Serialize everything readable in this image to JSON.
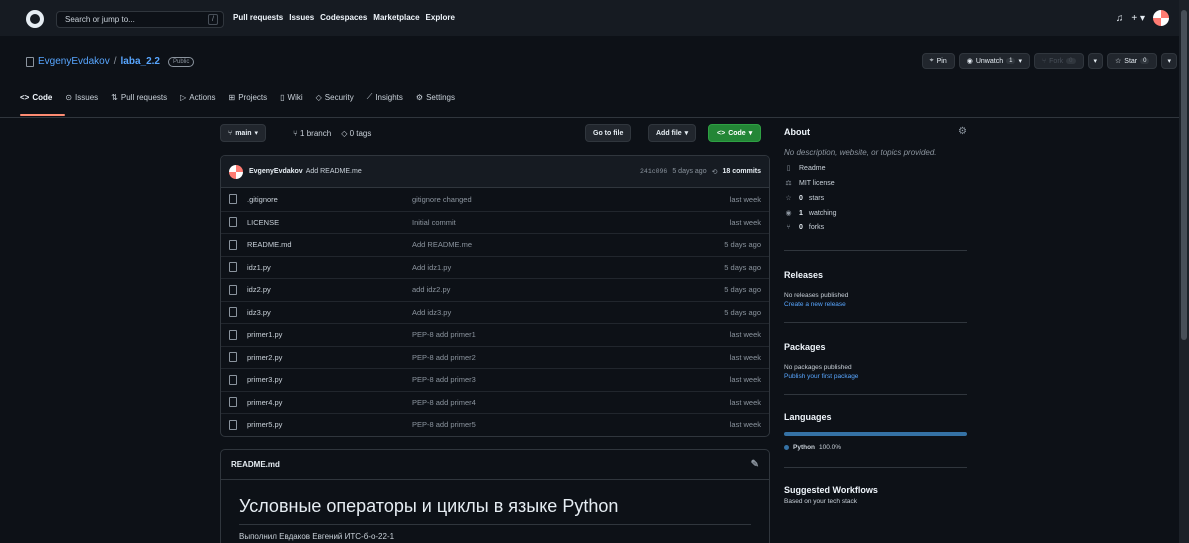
{
  "header": {
    "search_placeholder": "Search or jump to...",
    "slash_key": "/",
    "nav": [
      "Pull requests",
      "Issues",
      "Codespaces",
      "Marketplace",
      "Explore"
    ],
    "notification_icon": "bell-icon",
    "plus_icon": "plus-icon"
  },
  "repo": {
    "owner": "EvgenyEvdakov",
    "separator": "/",
    "name": "laba_2.2",
    "visibility": "Public",
    "pin_label": "Pin",
    "unwatch_label": "Unwatch",
    "unwatch_count": "1",
    "fork_label": "Fork",
    "fork_count": "0",
    "star_label": "Star",
    "star_count": "0"
  },
  "tabs": [
    {
      "label": "Code",
      "icon": "<>"
    },
    {
      "label": "Issues",
      "icon": "⊙"
    },
    {
      "label": "Pull requests",
      "icon": "⇅"
    },
    {
      "label": "Actions",
      "icon": "▷"
    },
    {
      "label": "Projects",
      "icon": "⊞"
    },
    {
      "label": "Wiki",
      "icon": "▯"
    },
    {
      "label": "Security",
      "icon": "◇"
    },
    {
      "label": "Insights",
      "icon": "⟋"
    },
    {
      "label": "Settings",
      "icon": "⚙"
    }
  ],
  "toolbar": {
    "branch": "main",
    "branches": "1 branch",
    "tags": "0 tags",
    "go_to_file": "Go to file",
    "add_file": "Add file",
    "code": "Code"
  },
  "commit": {
    "author": "EvgenyEvdakov",
    "message": "Add README.me",
    "hash": "241c096",
    "age": "5 days ago",
    "count": "18 commits"
  },
  "files": [
    {
      "name": ".gitignore",
      "message": "gitignore changed",
      "age": "last week"
    },
    {
      "name": "LICENSE",
      "message": "Initial commit",
      "age": "last week"
    },
    {
      "name": "README.md",
      "message": "Add README.me",
      "age": "5 days ago"
    },
    {
      "name": "idz1.py",
      "message": "Add idz1.py",
      "age": "5 days ago"
    },
    {
      "name": "idz2.py",
      "message": "add idz2.py",
      "age": "5 days ago"
    },
    {
      "name": "idz3.py",
      "message": "Add idz3.py",
      "age": "5 days ago"
    },
    {
      "name": "primer1.py",
      "message": "PEP-8 add primer1",
      "age": "last week"
    },
    {
      "name": "primer2.py",
      "message": "PEP-8 add primer2",
      "age": "last week"
    },
    {
      "name": "primer3.py",
      "message": "PEP-8 add primer3",
      "age": "last week"
    },
    {
      "name": "primer4.py",
      "message": "PEP-8 add primer4",
      "age": "last week"
    },
    {
      "name": "primer5.py",
      "message": "PEP-8 add primer5",
      "age": "last week"
    }
  ],
  "readme": {
    "file": "README.md",
    "title": "Условные операторы и циклы в языке Python",
    "line": "Выполнил Евдаков Евгений ИТС-б-о-22-1"
  },
  "sidebar": {
    "about": "About",
    "description": "No description, website, or topics provided.",
    "readme": "Readme",
    "license": "MIT license",
    "stars_num": "0",
    "stars": "stars",
    "watching_num": "1",
    "watching": "watching",
    "forks_num": "0",
    "forks": "forks",
    "releases": "Releases",
    "no_releases": "No releases published",
    "create_release": "Create a new release",
    "packages": "Packages",
    "no_packages": "No packages published",
    "publish_package": "Publish your first package",
    "languages": "Languages",
    "lang_name": "Python",
    "lang_pct": "100.0%",
    "suggested": "Suggested Workflows",
    "based_on": "Based on your tech stack"
  },
  "colors": {
    "accent_green": "#238636",
    "link_blue": "#58a6ff",
    "python": "#3572a5",
    "tab_underline": "#fd8c73"
  }
}
